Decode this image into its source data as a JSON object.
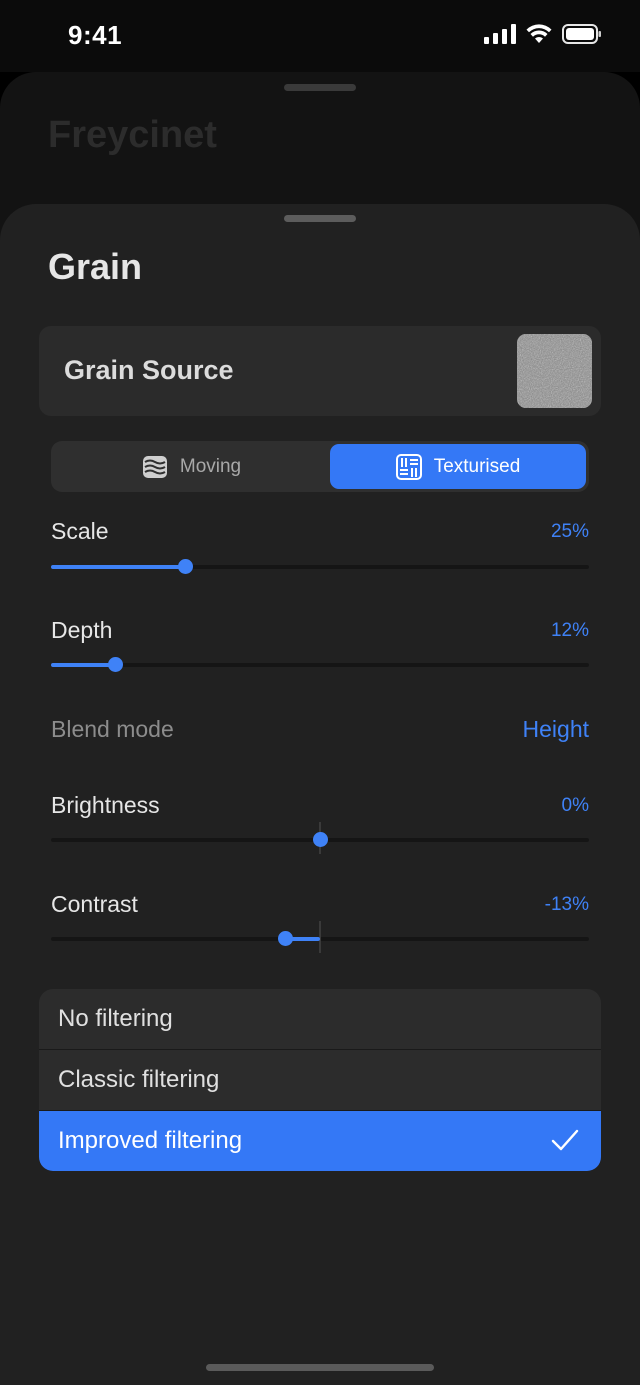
{
  "status_bar": {
    "time": "9:41",
    "icons": [
      "signal-icon",
      "wifi-icon",
      "battery-icon"
    ]
  },
  "background_sheet": {
    "title": "Freycinet"
  },
  "sheet": {
    "title": "Grain",
    "grain_source": {
      "label": "Grain Source"
    },
    "segmented": {
      "options": [
        {
          "label": "Moving",
          "icon": "wave-stack-icon",
          "selected": false
        },
        {
          "label": "Texturised",
          "icon": "texture-grid-icon",
          "selected": true
        }
      ]
    },
    "scale": {
      "label": "Scale",
      "value": "25%",
      "level": 0.25
    },
    "depth": {
      "label": "Depth",
      "value": "12%",
      "level": 0.12
    },
    "blend_mode": {
      "label": "Blend mode",
      "value": "Height"
    },
    "brightness": {
      "label": "Brightness",
      "value": "0%",
      "level": 0.0
    },
    "contrast": {
      "label": "Contrast",
      "value": "-13%",
      "level": -0.13
    },
    "filtering": {
      "options": [
        "No filtering",
        "Classic filtering",
        "Improved filtering"
      ],
      "selected": "Improved filtering"
    }
  },
  "colors": {
    "accent": "#3478f6",
    "sheet": "#212121",
    "card": "#2b2b2b"
  }
}
